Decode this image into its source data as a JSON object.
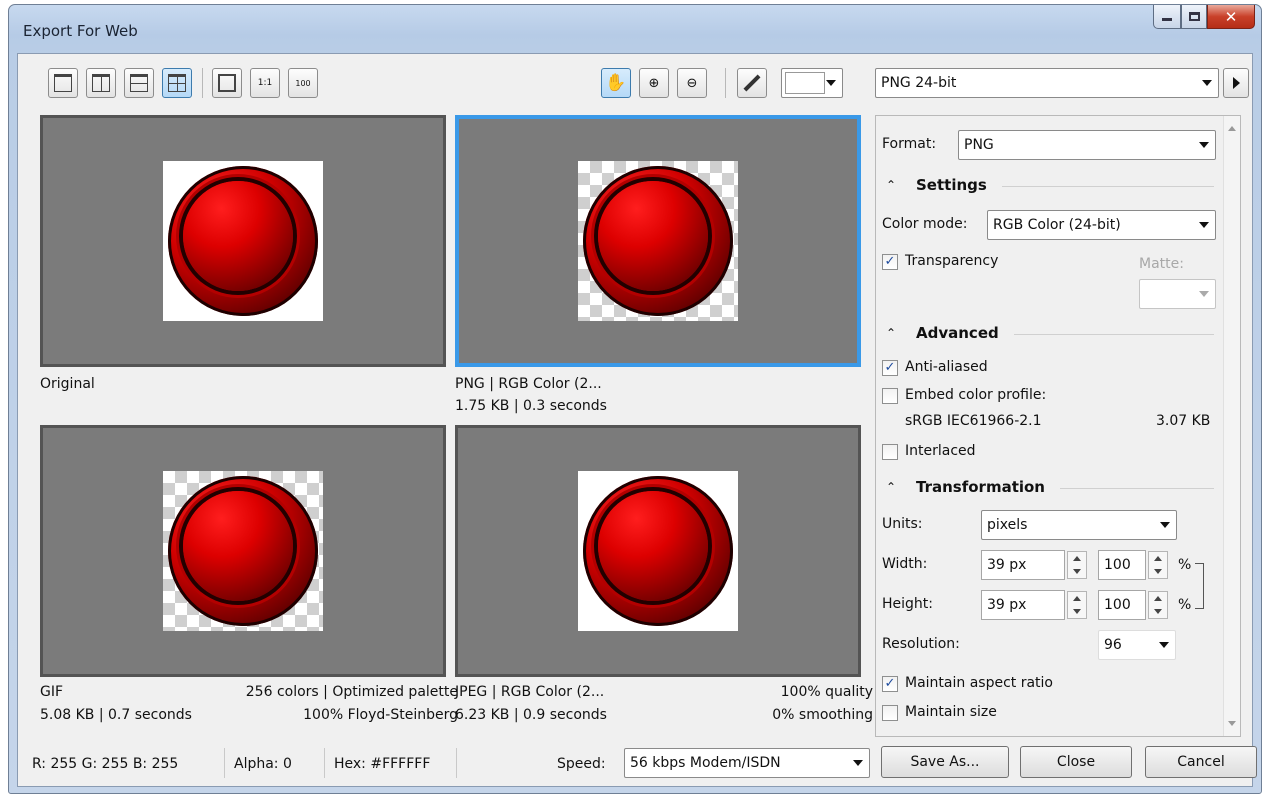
{
  "window": {
    "title": "Export For Web"
  },
  "toolbar": {
    "preset": "PNG 24-bit",
    "background_color": "#FFFFFF"
  },
  "previews": {
    "original": {
      "line1": "Original"
    },
    "png": {
      "line1": "PNG  |  RGB Color (2...",
      "line2": "1.75 KB  |  0.3 seconds"
    },
    "gif": {
      "left1": "GIF",
      "right1": "256 colors  |  Optimized palette",
      "left2": "5.08 KB  |  0.7 seconds",
      "right2": "100% Floyd-Steinberg"
    },
    "jpeg": {
      "left1": "JPEG  |  RGB Color (2...",
      "right1": "100% quality",
      "left2": "6.23 KB  |  0.9 seconds",
      "right2": "0% smoothing"
    }
  },
  "settings": {
    "format_label": "Format:",
    "format_value": "PNG",
    "settings_heading": "Settings",
    "color_mode_label": "Color mode:",
    "color_mode_value": "RGB Color (24-bit)",
    "transparency_label": "Transparency",
    "transparency_checked": true,
    "matte_label": "Matte:",
    "advanced_heading": "Advanced",
    "anti_aliased_label": "Anti-aliased",
    "anti_aliased_checked": true,
    "embed_profile_label": "Embed color profile:",
    "embed_profile_checked": false,
    "profile_name": "sRGB IEC61966-2.1",
    "profile_size": "3.07 KB",
    "interlaced_label": "Interlaced",
    "interlaced_checked": false,
    "transformation_heading": "Transformation",
    "units_label": "Units:",
    "units_value": "pixels",
    "width_label": "Width:",
    "width_px": "39 px",
    "width_pct": "100",
    "height_label": "Height:",
    "height_px": "39 px",
    "height_pct": "100",
    "pct_symbol": "%",
    "resolution_label": "Resolution:",
    "resolution_value": "96",
    "maintain_aspect_label": "Maintain aspect ratio",
    "maintain_aspect_checked": true,
    "maintain_size_label": "Maintain size",
    "maintain_size_checked": false
  },
  "status": {
    "rgb": "R: 255   G: 255   B: 255",
    "alpha": "Alpha: 0",
    "hex": "Hex: #FFFFFF",
    "speed_label": "Speed:",
    "speed_value": "56 kbps Modem/ISDN"
  },
  "buttons": {
    "save_as": "Save As...",
    "close": "Close",
    "cancel": "Cancel"
  },
  "colors": {
    "selection_border": "#3a99e8",
    "preview_bg": "#7b7b7b"
  }
}
